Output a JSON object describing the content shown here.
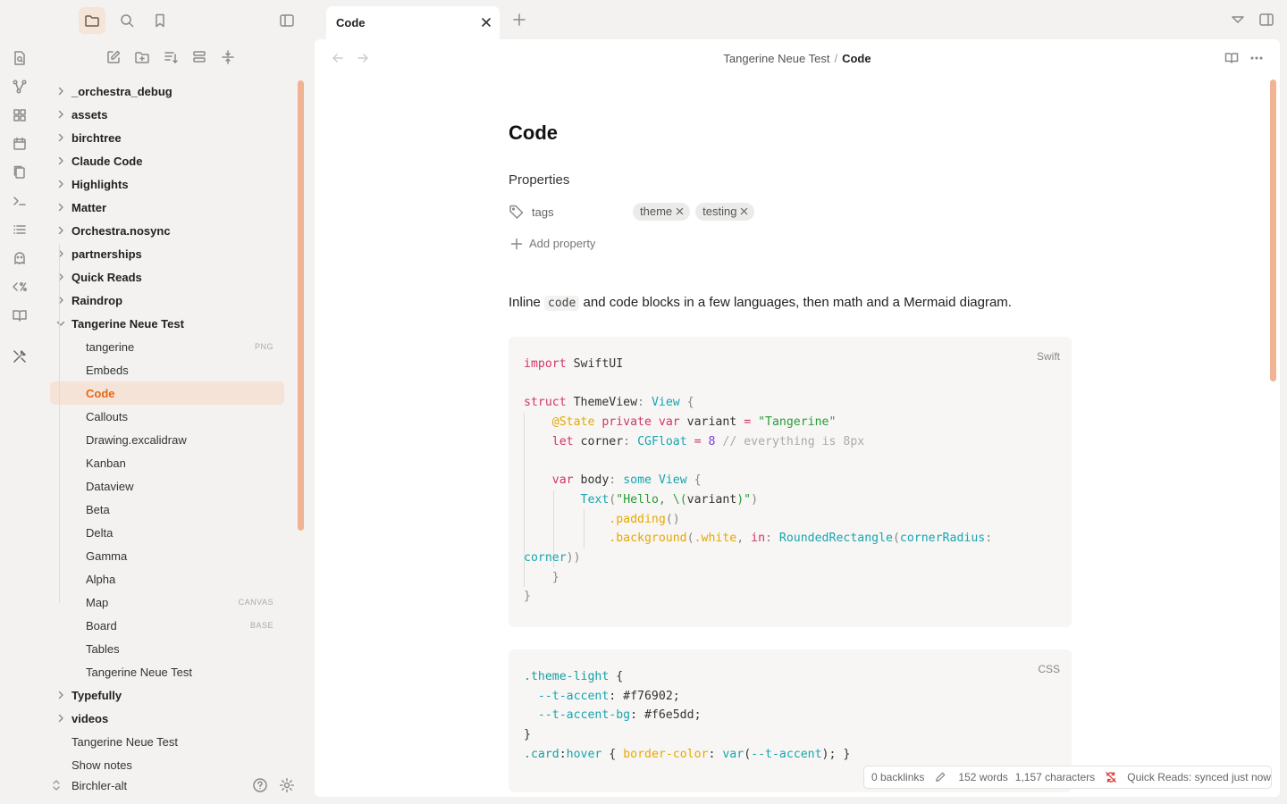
{
  "tab": {
    "title": "Code"
  },
  "breadcrumb": {
    "folder": "Tangerine Neue Test",
    "separator": "/",
    "current": "Code"
  },
  "tree": [
    {
      "label": "_orchestra_debug",
      "kind": "folder"
    },
    {
      "label": "assets",
      "kind": "folder"
    },
    {
      "label": "birchtree",
      "kind": "folder"
    },
    {
      "label": "Claude Code",
      "kind": "folder"
    },
    {
      "label": "Highlights",
      "kind": "folder"
    },
    {
      "label": "Matter",
      "kind": "folder"
    },
    {
      "label": "Orchestra.nosync",
      "kind": "folder"
    },
    {
      "label": "partnerships",
      "kind": "folder"
    },
    {
      "label": "Quick Reads",
      "kind": "folder"
    },
    {
      "label": "Raindrop",
      "kind": "folder"
    },
    {
      "label": "Tangerine Neue Test",
      "kind": "folder-open"
    },
    {
      "label": "tangerine",
      "kind": "file",
      "badge": "PNG"
    },
    {
      "label": "Embeds",
      "kind": "file"
    },
    {
      "label": "Code",
      "kind": "file",
      "active": true
    },
    {
      "label": "Callouts",
      "kind": "file"
    },
    {
      "label": "Drawing.excalidraw",
      "kind": "file"
    },
    {
      "label": "Kanban",
      "kind": "file"
    },
    {
      "label": "Dataview",
      "kind": "file"
    },
    {
      "label": "Beta",
      "kind": "file"
    },
    {
      "label": "Delta",
      "kind": "file"
    },
    {
      "label": "Gamma",
      "kind": "file"
    },
    {
      "label": "Alpha",
      "kind": "file"
    },
    {
      "label": "Map",
      "kind": "file",
      "badge": "CANVAS"
    },
    {
      "label": "Board",
      "kind": "file",
      "badge": "BASE"
    },
    {
      "label": "Tables",
      "kind": "file"
    },
    {
      "label": "Tangerine Neue Test",
      "kind": "file"
    },
    {
      "label": "Typefully",
      "kind": "folder"
    },
    {
      "label": "videos",
      "kind": "folder"
    },
    {
      "label": "Tangerine Neue Test",
      "kind": "root"
    },
    {
      "label": "Show notes",
      "kind": "root"
    }
  ],
  "vault": {
    "name": "Birchler-alt"
  },
  "note": {
    "title": "Code",
    "properties_heading": "Properties",
    "property_name": "tags",
    "tags": [
      "theme",
      "testing"
    ],
    "add_property": "Add property",
    "intro_before": "Inline ",
    "intro_code": "code",
    "intro_after": " and code blocks in a few languages, then math and a Mermaid diagram."
  },
  "code_blocks": [
    {
      "language": "Swift"
    },
    {
      "language": "CSS"
    }
  ],
  "status": {
    "backlinks": "0 backlinks",
    "words": "152 words",
    "characters": "1,157 characters",
    "sync": "Quick Reads: synced just now"
  },
  "colors": {
    "accent": "#f76902",
    "accent_bg": "#f6e5dd"
  }
}
